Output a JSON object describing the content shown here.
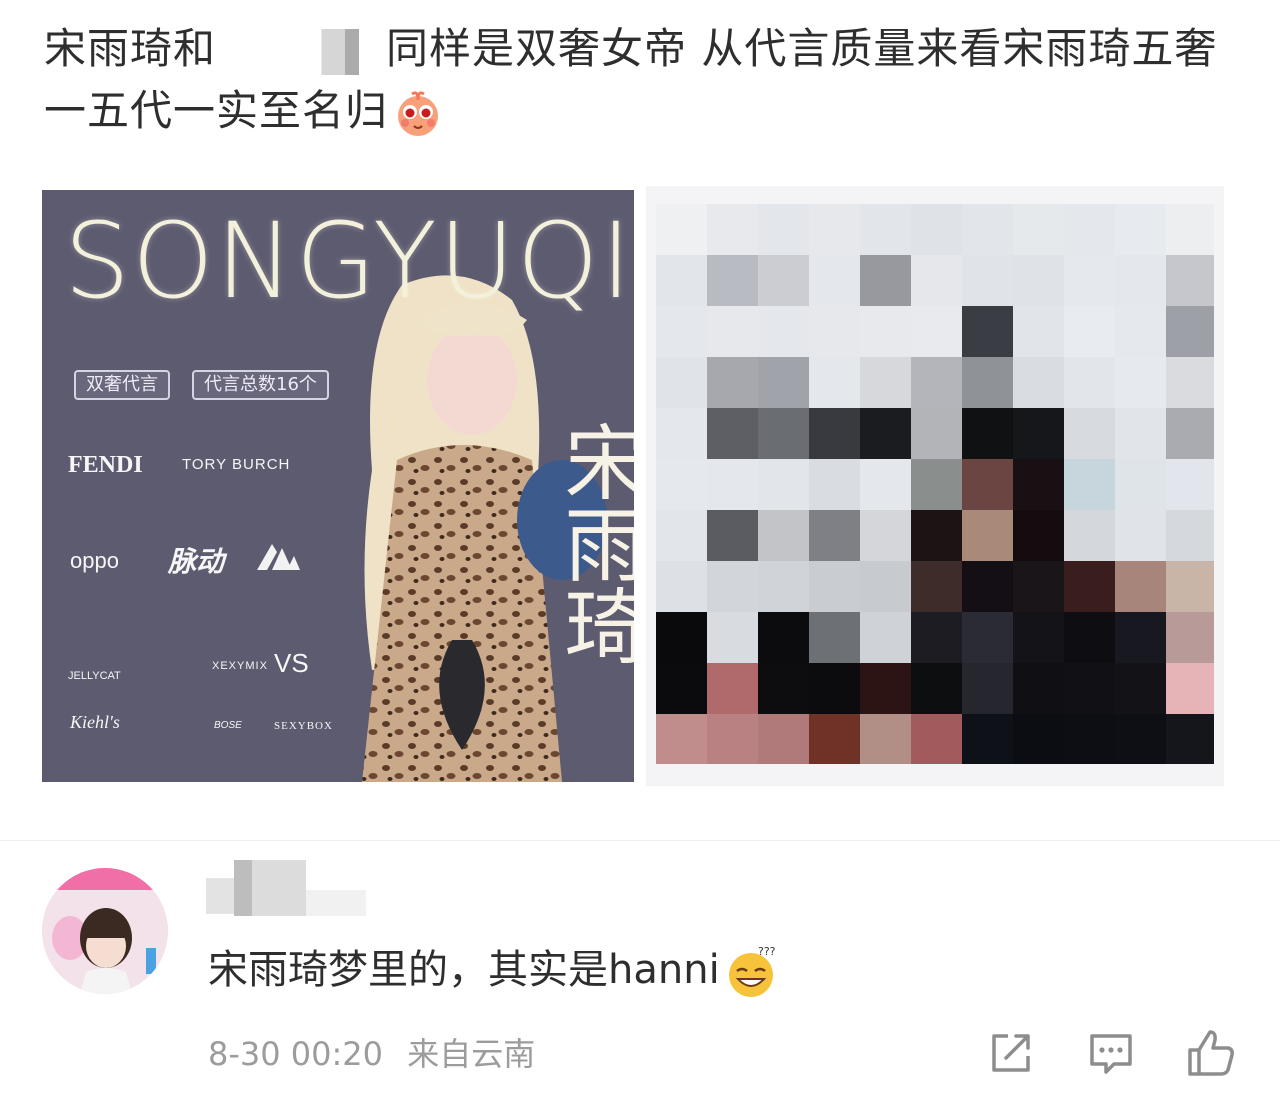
{
  "post": {
    "text_part1": "宋雨琦和",
    "text_part2": "同样是双奢女帝 从代言质量来看宋雨琦五奢一五代一实至名归"
  },
  "poster": {
    "title": "SONGYUQI",
    "tag1": "双奢代言",
    "tag2": "代言总数16个",
    "vertical_name": "宋雨琦",
    "brands": {
      "fendi": "FENDI",
      "tory": "TORY BURCH",
      "oppo": "oppo",
      "maidong": "脉动",
      "jellycat": "JELLYCAT",
      "xexymix": "XEXYMIX",
      "vs": "VS",
      "kiehls": "Kiehl's",
      "bose": "BOSE",
      "sexybox": "SEXYBOX"
    }
  },
  "comment": {
    "text": "宋雨琦梦里的，其实是hanni",
    "date": "8-30 00:20",
    "location": "来自云南"
  },
  "icons": {
    "post_emoji": "shy-face-icon",
    "comment_emoji": "confused-grin-icon",
    "share": "share-icon",
    "reply": "comment-icon",
    "like": "thumbs-up-icon"
  }
}
